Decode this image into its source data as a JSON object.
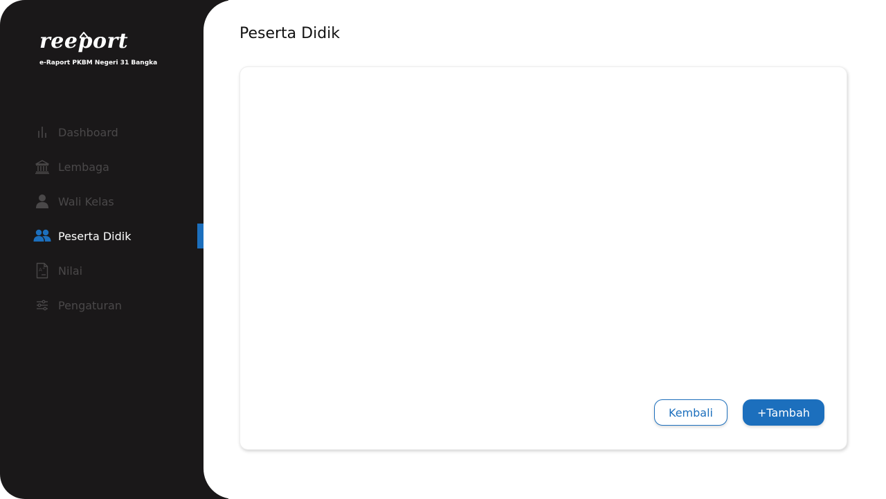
{
  "brand": {
    "logo_text": "reeport",
    "subtitle": "e-Raport PKBM Negeri 31 Bangka"
  },
  "sidebar": {
    "items": [
      {
        "label": "Dashboard",
        "icon": "bar-chart-icon",
        "active": false
      },
      {
        "label": "Lembaga",
        "icon": "institution-icon",
        "active": false
      },
      {
        "label": "Wali Kelas",
        "icon": "user-icon",
        "active": false
      },
      {
        "label": "Peserta Didik",
        "icon": "users-icon",
        "active": true
      },
      {
        "label": "Nilai",
        "icon": "grade-document-icon",
        "active": false
      },
      {
        "label": "Pengaturan",
        "icon": "sliders-icon",
        "active": false
      }
    ]
  },
  "main": {
    "title": "Peserta Didik",
    "buttons": {
      "back_label": "Kembali",
      "add_label": "+Tambah"
    }
  },
  "colors": {
    "sidebar_bg": "#1a1819",
    "accent": "#1c6fbd",
    "inactive_text": "#4a4849"
  }
}
